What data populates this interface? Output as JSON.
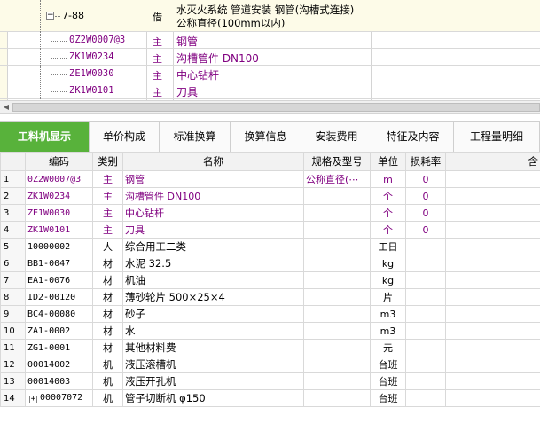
{
  "tree": {
    "parent": {
      "code": "7-88",
      "type": "借",
      "name_line1": "水灭火系统 管道安装 钢管(沟槽式连接)",
      "name_line2": "公称直径(100mm以内)"
    },
    "children": [
      {
        "code": "0Z2W0007@3",
        "type": "主",
        "name": "钢管"
      },
      {
        "code": "ZK1W0234",
        "type": "主",
        "name": "沟槽管件 DN100"
      },
      {
        "code": "ZE1W0030",
        "type": "主",
        "name": "中心钻杆"
      },
      {
        "code": "ZK1W0101",
        "type": "主",
        "name": "刀具"
      }
    ]
  },
  "tabs": [
    {
      "label": "工料机显示",
      "active": true
    },
    {
      "label": "单价构成"
    },
    {
      "label": "标准换算"
    },
    {
      "label": "换算信息"
    },
    {
      "label": "安装费用"
    },
    {
      "label": "特征及内容"
    },
    {
      "label": "工程量明细"
    }
  ],
  "table": {
    "headers": {
      "code": "编码",
      "type": "类别",
      "name": "名称",
      "spec": "规格及型号",
      "unit": "单位",
      "loss": "损耗率",
      "extra": "含"
    },
    "rows": [
      {
        "n": "1",
        "code": "0Z2W0007@3",
        "type": "主",
        "name": "钢管",
        "spec": "公称直径(⋯",
        "unit": "m",
        "loss": "0",
        "main": true
      },
      {
        "n": "2",
        "code": "ZK1W0234",
        "type": "主",
        "name": "沟槽管件 DN100",
        "spec": "",
        "unit": "个",
        "loss": "0",
        "main": true
      },
      {
        "n": "3",
        "code": "ZE1W0030",
        "type": "主",
        "name": "中心钻杆",
        "spec": "",
        "unit": "个",
        "loss": "0",
        "main": true
      },
      {
        "n": "4",
        "code": "ZK1W0101",
        "type": "主",
        "name": "刀具",
        "spec": "",
        "unit": "个",
        "loss": "0",
        "main": true
      },
      {
        "n": "5",
        "code": "10000002",
        "type": "人",
        "name": "综合用工二类",
        "spec": "",
        "unit": "工日",
        "loss": ""
      },
      {
        "n": "6",
        "code": "BB1-0047",
        "type": "材",
        "name": "水泥 32.5",
        "spec": "",
        "unit": "kg",
        "loss": ""
      },
      {
        "n": "7",
        "code": "EA1-0076",
        "type": "材",
        "name": "机油",
        "spec": "",
        "unit": "kg",
        "loss": ""
      },
      {
        "n": "8",
        "code": "ID2-00120",
        "type": "材",
        "name": "薄砂轮片 500×25×4",
        "spec": "",
        "unit": "片",
        "loss": ""
      },
      {
        "n": "9",
        "code": "BC4-00080",
        "type": "材",
        "name": "砂子",
        "spec": "",
        "unit": "m3",
        "loss": ""
      },
      {
        "n": "10",
        "code": "ZA1-0002",
        "type": "材",
        "name": "水",
        "spec": "",
        "unit": "m3",
        "loss": ""
      },
      {
        "n": "11",
        "code": "ZG1-0001",
        "type": "材",
        "name": "其他材料费",
        "spec": "",
        "unit": "元",
        "loss": ""
      },
      {
        "n": "12",
        "code": "00014002",
        "type": "机",
        "name": "液压滚槽机",
        "spec": "",
        "unit": "台班",
        "loss": ""
      },
      {
        "n": "13",
        "code": "00014003",
        "type": "机",
        "name": "液压开孔机",
        "spec": "",
        "unit": "台班",
        "loss": ""
      },
      {
        "n": "14",
        "code": "00007072",
        "type": "机",
        "name": "管子切断机 φ150",
        "spec": "",
        "unit": "台班",
        "loss": "",
        "expandable": true
      }
    ]
  },
  "colors": {
    "accent_green": "#58b23b",
    "main_purple": "#800080"
  }
}
